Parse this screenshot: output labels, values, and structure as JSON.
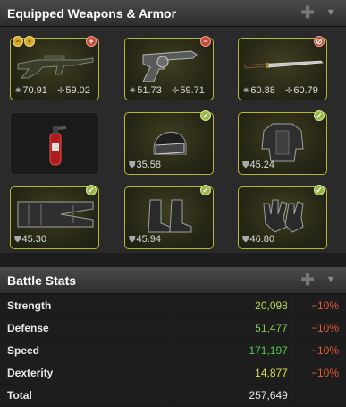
{
  "weapons_panel": {
    "title": "Equipped Weapons & Armor",
    "items": [
      {
        "name": "assault rifle",
        "equipped": true,
        "damage": "70.91",
        "accuracy": "59.02"
      },
      {
        "name": "revolver",
        "equipped": true,
        "damage": "51.73",
        "accuracy": "59.71"
      },
      {
        "name": "katana",
        "equipped": true,
        "damage": "60.88",
        "accuracy": "60.79"
      },
      {
        "name": "fire extinguisher",
        "equipped": false
      },
      {
        "name": "riot helmet",
        "equipped": true,
        "armor": "35.58"
      },
      {
        "name": "riot body",
        "equipped": true,
        "armor": "45.24"
      },
      {
        "name": "riot pants",
        "equipped": true,
        "armor": "45.30"
      },
      {
        "name": "riot boots",
        "equipped": true,
        "armor": "45.94"
      },
      {
        "name": "riot gloves",
        "equipped": true,
        "armor": "46.80"
      }
    ],
    "badge_colors": {
      "green": "#9ab84a",
      "red": "#c24a3a",
      "yellow": "#d8a928"
    }
  },
  "battle_stats": {
    "title": "Battle Stats",
    "rows": [
      {
        "label": "Strength",
        "value": "20,098",
        "modifier": "−10%",
        "color": "#b9d95a"
      },
      {
        "label": "Defense",
        "value": "51,477",
        "modifier": "−10%",
        "color": "#88cc55"
      },
      {
        "label": "Speed",
        "value": "171,197",
        "modifier": "−10%",
        "color": "#4dcc4d"
      },
      {
        "label": "Dexterity",
        "value": "14,877",
        "modifier": "−10%",
        "color": "#d6e24a"
      },
      {
        "label": "Total",
        "value": "257,649",
        "modifier": "",
        "color": "#e8e8e8"
      }
    ]
  },
  "colors": {
    "equipped_border": "#b8b82e",
    "negative": "#e05a3a",
    "header_text": "#ffffff"
  }
}
